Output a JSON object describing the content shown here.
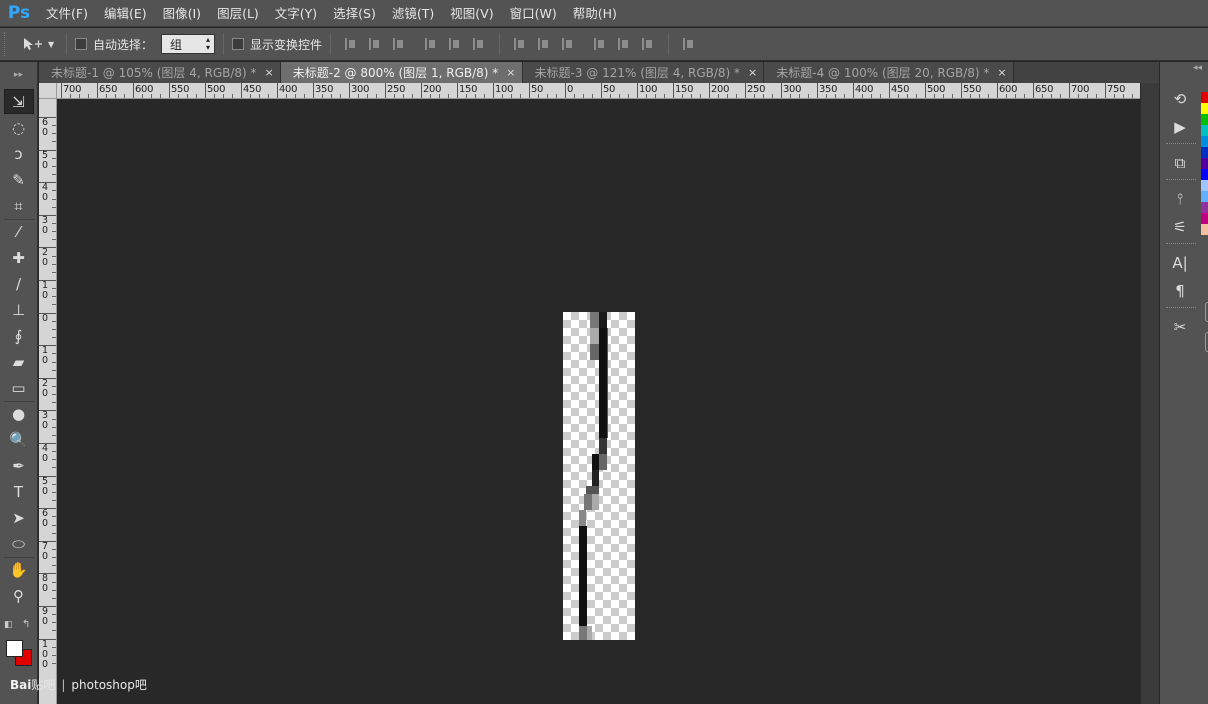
{
  "app": {
    "logo": "Ps"
  },
  "menu": [
    "文件(F)",
    "编辑(E)",
    "图像(I)",
    "图层(L)",
    "文字(Y)",
    "选择(S)",
    "滤镜(T)",
    "视图(V)",
    "窗口(W)",
    "帮助(H)"
  ],
  "options": {
    "tool_preset_icon": "move-tool-icon",
    "auto_select_label": "自动选择：",
    "auto_select_checked": false,
    "auto_select_value": "组",
    "show_transform_label": "显示变换控件",
    "show_transform_checked": false
  },
  "tabs": [
    {
      "label": "未标题-1 @ 105% (图层 4, RGB/8) *",
      "active": false
    },
    {
      "label": "未标题-2 @ 800% (图层 1, RGB/8) *",
      "active": true
    },
    {
      "label": "未标题-3 @ 121% (图层 4, RGB/8) *",
      "active": false
    },
    {
      "label": "未标题-4 @ 100% (图层 20, RGB/8) *",
      "active": false
    }
  ],
  "tab_close_glyph": "×",
  "ruler_top_labels": [
    "700",
    "650",
    "600",
    "550",
    "500",
    "450",
    "400",
    "350",
    "300",
    "250",
    "200",
    "150",
    "100",
    "50",
    "0",
    "50",
    "100",
    "150",
    "200",
    "250",
    "300",
    "350",
    "400",
    "450",
    "500",
    "550",
    "600",
    "650",
    "700",
    "750"
  ],
  "ruler_left_labels": [
    "6 0",
    "5 0",
    "4 0",
    "3 0",
    "2 0",
    "1 0",
    "0",
    "1 0",
    "2 0",
    "3 0",
    "4 0",
    "5 0",
    "6 0",
    "7 0",
    "8 0",
    "9 0",
    "1 0 0"
  ],
  "tools": [
    "move-tool-icon",
    "elliptical-marquee-icon",
    "lasso-icon",
    "quick-selection-icon",
    "crop-icon",
    "eyedropper-icon",
    "healing-brush-icon",
    "brush-icon",
    "clone-stamp-icon",
    "history-brush-icon",
    "eraser-icon",
    "gradient-icon",
    "blur-icon",
    "dodge-icon",
    "pen-icon",
    "type-icon",
    "path-selection-icon",
    "ellipse-shape-icon",
    "hand-icon",
    "zoom-icon"
  ],
  "colors": {
    "foreground": "#ffffff",
    "background": "#e00000",
    "ps_blue": "#31a8ff"
  },
  "watermark": {
    "logo": "Bai",
    "logo2": "贴吧",
    "sep": "|",
    "text": "photoshop吧"
  },
  "right_panel_icons": [
    "history-icon",
    "actions-play-icon",
    "3d-icon",
    "brush-presets-icon",
    "adjustments-icon",
    "character-icon",
    "paragraph-icon",
    "tools-icon"
  ],
  "swatch_colors": [
    "#e00000",
    "#ffff00",
    "#00c000",
    "#00c0c0",
    "#0090e0",
    "#0030c0",
    "#5000a0",
    "#0000ff",
    "#9fc5ff",
    "#60b0ff",
    "#9030a0",
    "#c00080",
    "#f0c0a0"
  ]
}
